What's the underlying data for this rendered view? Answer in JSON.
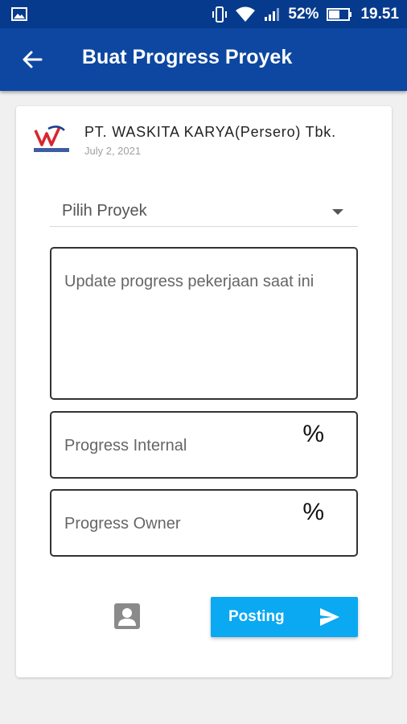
{
  "status_bar": {
    "battery": "52%",
    "time": "19.51",
    "icons": [
      "image-icon",
      "vibrate-icon",
      "wifi-icon",
      "signal-icon",
      "battery-icon"
    ]
  },
  "app_bar": {
    "title": "Buat Progress Proyek",
    "back_icon": "arrow-left-icon"
  },
  "card": {
    "company": "PT. WASKITA KARYA(Persero) Tbk.",
    "date": "July 2, 2021",
    "logo_text": "WASKITA",
    "project_select": {
      "value": "Pilih Proyek"
    },
    "description": {
      "placeholder": "Update progress pekerjaan saat ini"
    },
    "progress_internal": {
      "placeholder": "Progress Internal",
      "unit": "%"
    },
    "progress_owner": {
      "placeholder": "Progress Owner",
      "unit": "%"
    },
    "attach_icon": "account-box-icon",
    "post_button": {
      "label": "Posting",
      "icon": "send-icon"
    }
  },
  "colors": {
    "status_bar": "#063a8c",
    "app_bar": "#0d47a1",
    "accent": "#0aa9f2"
  }
}
